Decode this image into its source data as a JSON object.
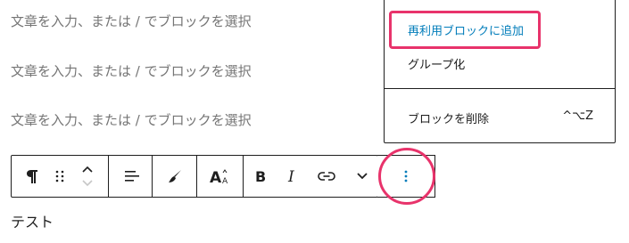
{
  "placeholders": [
    "文章を入力、または / でブロックを選択",
    "文章を入力、または / でブロックを選択",
    "文章を入力、または / でブロックを選択"
  ],
  "menu": {
    "items": [
      {
        "label": "再利用ブロックに追加",
        "highlighted": true
      },
      {
        "label": "グループ化"
      },
      {
        "label": "ブロックを削除",
        "shortcut": "^⌥Z"
      }
    ]
  },
  "toolbar": {
    "buttons": [
      {
        "icon": "paragraph-icon"
      },
      {
        "icon": "drag-handle-icon"
      },
      {
        "icon": "move-up-down-icon"
      },
      {
        "icon": "align-icon"
      },
      {
        "icon": "brush-icon"
      },
      {
        "icon": "text-size-icon"
      },
      {
        "icon": "bold-icon"
      },
      {
        "icon": "italic-icon"
      },
      {
        "icon": "link-icon"
      },
      {
        "icon": "chevron-down-icon"
      },
      {
        "icon": "more-options-icon"
      }
    ]
  },
  "content": {
    "text": "テスト"
  },
  "colors": {
    "accent": "#007cba",
    "highlight": "#e8336b"
  }
}
